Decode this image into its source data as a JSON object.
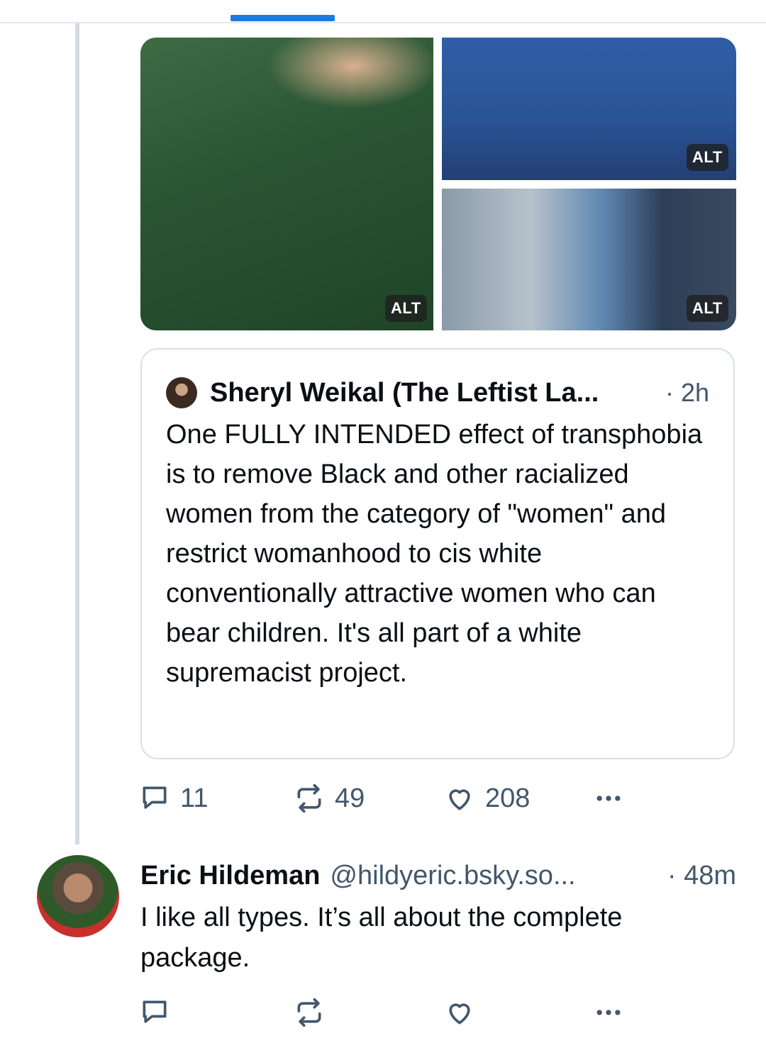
{
  "media": {
    "alt_badges": [
      "ALT",
      "ALT",
      "ALT"
    ]
  },
  "quote": {
    "author": "Sheryl Weikal (The Leftist La...",
    "time": "· 2h",
    "text": "One FULLY INTENDED effect of transphobia is to remove Black and other racialized women from the category of \"women\" and restrict womanhood to cis white conventionally attractive women who can bear children. It's all part of a white supremacist project."
  },
  "post_actions": {
    "replies": "11",
    "reposts": "49",
    "likes": "208"
  },
  "reply": {
    "name": "Eric Hildeman",
    "handle": "@hildyeric.bsky.so...",
    "time": "· 48m",
    "text": "I like all types. It’s all about the complete package."
  },
  "icons": {
    "reply": "comment-icon",
    "repost": "repost-icon",
    "like": "heart-icon",
    "more": "more-icon"
  },
  "colors": {
    "accent": "#1f7ae0",
    "muted": "#42576c"
  }
}
